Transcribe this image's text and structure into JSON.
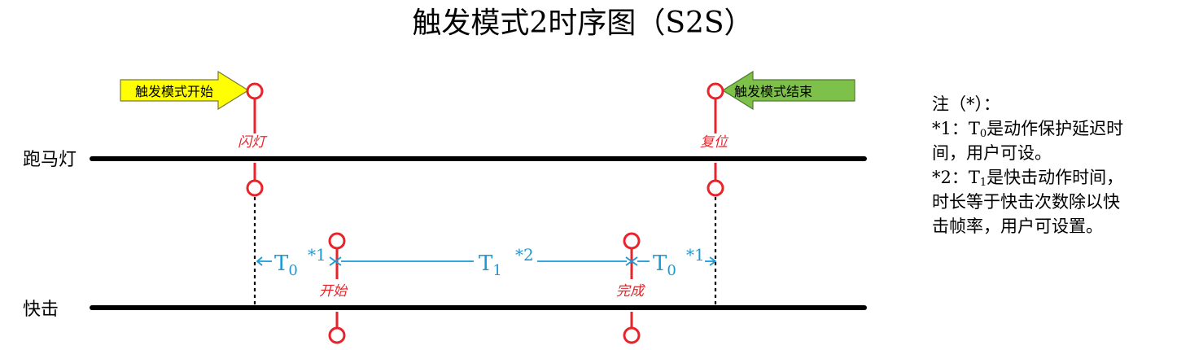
{
  "title": "触发模式2时序图（S2S）",
  "rows": {
    "top": "跑马灯",
    "bottom": "快击"
  },
  "arrows": {
    "start": "触发模式开始",
    "end": "触发模式结束"
  },
  "events": {
    "flash": "闪灯",
    "reset": "复位",
    "begin": "开始",
    "done": "完成"
  },
  "intervals": {
    "t0_a": {
      "symbol": "T",
      "subscript": "0",
      "note_ref": "*1"
    },
    "t1": {
      "symbol": "T",
      "subscript": "1",
      "note_ref": "*2"
    },
    "t0_b": {
      "symbol": "T",
      "subscript": "0",
      "note_ref": "*1"
    }
  },
  "notes": {
    "heading": "注（*）：",
    "n1_a": "*1：T",
    "n1_sub": "0",
    "n1_b": "是动作保护延迟时",
    "n1_c": "间，用户可设。",
    "n2_a": "*2：T",
    "n2_sub": "1",
    "n2_b": "是快击动作时间，",
    "n2_c": "时长等于快击次数除以快",
    "n2_d": "击帧率，用户可设置。"
  },
  "colors": {
    "event": "#e8232a",
    "interval": "#1c9ad6",
    "start_arrow": "#ffff00",
    "end_arrow": "#7dc04a",
    "line": "#000000"
  }
}
